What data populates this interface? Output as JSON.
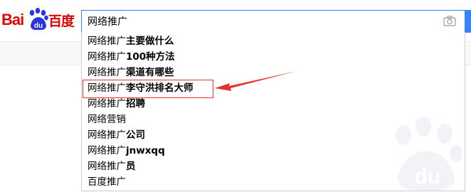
{
  "logo": {
    "text_prefix": "Bai",
    "text_paw": "du",
    "text_cn": "百度"
  },
  "search": {
    "value": "网络推广",
    "placeholder": ""
  },
  "suggestions": [
    {
      "prefix": "网络推广",
      "rest": "主要做什么"
    },
    {
      "prefix": "网络推广",
      "rest": "100种方法"
    },
    {
      "prefix": "网络推广",
      "rest": "渠道有哪些"
    },
    {
      "prefix": "网络推广",
      "rest": "李守洪排名大师"
    },
    {
      "prefix": "网络推广",
      "rest": "招聘"
    },
    {
      "prefix": "网络营销",
      "rest": ""
    },
    {
      "prefix": "网络推广",
      "rest": "公司"
    },
    {
      "prefix": "网络推广",
      "rest": "jnwxqq"
    },
    {
      "prefix": "网络推广",
      "rest": "员"
    },
    {
      "prefix": "百度推广",
      "rest": ""
    }
  ],
  "colors": {
    "brand_red": "#e10601",
    "brand_blue": "#3385ff",
    "annotation_red": "#e5322d"
  },
  "icons": {
    "camera": "camera-icon",
    "paw": "baidu-paw-icon"
  }
}
